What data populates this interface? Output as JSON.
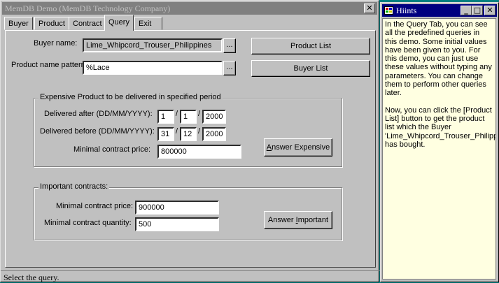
{
  "main_window": {
    "title": "MemDB Demo (MemDB Technology Company)",
    "close_glyph": "✕"
  },
  "tabs": [
    {
      "label": "Buyer"
    },
    {
      "label": "Product"
    },
    {
      "label": "Contract"
    },
    {
      "label": "Query"
    },
    {
      "label": "Exit"
    }
  ],
  "query": {
    "buyer_name_label": "Buyer name:",
    "buyer_name_value": "Lime_Whipcord_Trouser_Philippines",
    "product_pattern_label": "Product name pattern:",
    "product_pattern_value": "%Lace",
    "ellipsis": "...",
    "product_list_button": "Product List",
    "buyer_list_button": "Buyer List",
    "expensive": {
      "title": "Expensive Product to be delivered in specified period",
      "after_label": "Delivered after (DD/MM/YYYY):",
      "after_day": "1",
      "after_month": "1",
      "after_year": "2000",
      "before_label": "Delivered before (DD/MM/YYYY):",
      "before_day": "31",
      "before_month": "12",
      "before_year": "2000",
      "min_price_label": "Minimal contract price:",
      "min_price_value": "800000",
      "button_prefix": "",
      "button_key": "A",
      "button_rest": "nswer Expensive",
      "slash": "/"
    },
    "important": {
      "title": "Important contracts:",
      "min_price_label": "Minimal contract price:",
      "min_price_value": "900000",
      "min_qty_label": "Minimal contract quantity:",
      "min_qty_value": "500",
      "button_prefix": "Answer ",
      "button_key": "I",
      "button_rest": "mportant"
    }
  },
  "status_bar": {
    "text": "Select the query."
  },
  "hints_window": {
    "title": "Hiints",
    "minimize_glyph": "_",
    "maximize_glyph": "□",
    "close_glyph": "✕",
    "paragraph1": "In the Query Tab, you can see all the predefined queries in this demo.  Some initial values have been given to you.  For this demo, you can just use these values without typing any parameters.  You can change them to perform other queries later.",
    "paragraph2": "Now, you can click the [Product List] button to get the product list which the Buyer 'Lime_Whipcord_Trouser_Philippines' has bought."
  }
}
